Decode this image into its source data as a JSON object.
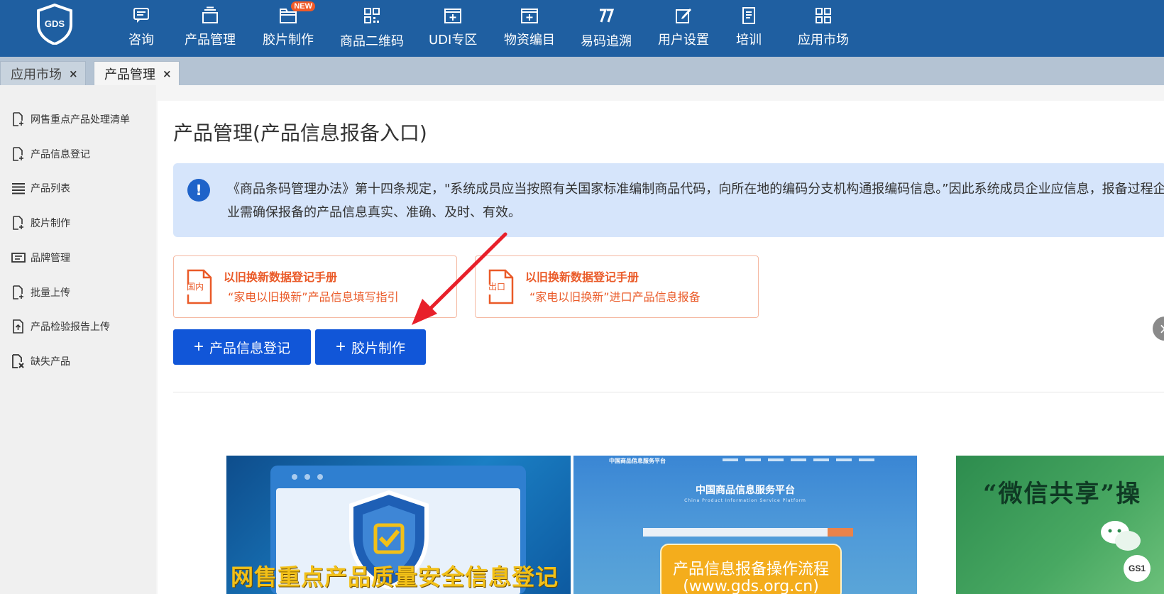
{
  "brand": {
    "logo_text": "GDS"
  },
  "nav": {
    "items": [
      {
        "label": "咨询",
        "icon": "chat-icon"
      },
      {
        "label": "产品管理",
        "icon": "box-stack-icon"
      },
      {
        "label": "胶片制作",
        "icon": "film-folder-icon",
        "badge": "NEW"
      },
      {
        "label": "商品二维码",
        "icon": "qrcode-icon"
      },
      {
        "label": "UDI专区",
        "icon": "plus-square-icon"
      },
      {
        "label": "物资编目",
        "icon": "catalog-icon"
      },
      {
        "label": "易码追溯",
        "icon": "trace-icon"
      },
      {
        "label": "用户设置",
        "icon": "edit-icon"
      },
      {
        "label": "培训",
        "icon": "book-icon"
      },
      {
        "label": "应用市场",
        "icon": "grid-icon"
      }
    ]
  },
  "tabs": [
    {
      "label": "应用市场",
      "close": "×",
      "active": false
    },
    {
      "label": "产品管理",
      "close": "×",
      "active": true
    }
  ],
  "sidebar": {
    "items": [
      {
        "label": "网售重点产品处理清单",
        "icon": "doc-plus-icon"
      },
      {
        "label": "产品信息登记",
        "icon": "doc-plus-icon"
      },
      {
        "label": "产品列表",
        "icon": "list-icon"
      },
      {
        "label": "胶片制作",
        "icon": "doc-plus-icon"
      },
      {
        "label": "品牌管理",
        "icon": "ticket-icon"
      },
      {
        "label": "批量上传",
        "icon": "doc-plus-icon"
      },
      {
        "label": "产品检验报告上传",
        "icon": "doc-upload-icon"
      },
      {
        "label": "缺失产品",
        "icon": "doc-x-icon"
      }
    ]
  },
  "main": {
    "title": "产品管理(产品信息报备入口)",
    "notice": {
      "icon": "!",
      "text": "《商品条码管理办法》第十四条规定，\"系统成员应当按照有关国家标准编制商品代码，向所在地的编码分支机构通报编码信息。”因此系统成员企业应信息，报备过程企业需确保报备的产品信息真实、准确、及时、有效。"
    },
    "manuals": [
      {
        "icon_label": "国内",
        "title": "以旧换新数据登记手册",
        "subtitle": "“家电以旧换新”产品信息填写指引"
      },
      {
        "icon_label": "出口",
        "title": "以旧换新数据登记手册",
        "subtitle": "“家电以旧换新”进口产品信息报备"
      }
    ],
    "buttons": {
      "register": "产品信息登记",
      "film": "胶片制作",
      "plus": "+"
    },
    "banners": {
      "b1_text": "网售重点产品质量安全信息登记",
      "b2_brand": "中国商品信息服务平台",
      "b2_platform": "中国商品信息服务平台",
      "b2_platform_en": "China Product Information Service Platform",
      "b2_card_title": "产品信息报备操作流程",
      "b2_card_url": "(www.gds.org.cn)",
      "b3_title": "“微信共享”操",
      "b3_logo": "GS1"
    }
  },
  "float_close": "×",
  "colors": {
    "topbar": "#1f5fa1",
    "primary_button": "#1156d8",
    "manual_accent": "#ea5a28",
    "notice_bg": "#d6e5fb",
    "arrow": "#e8202a"
  }
}
